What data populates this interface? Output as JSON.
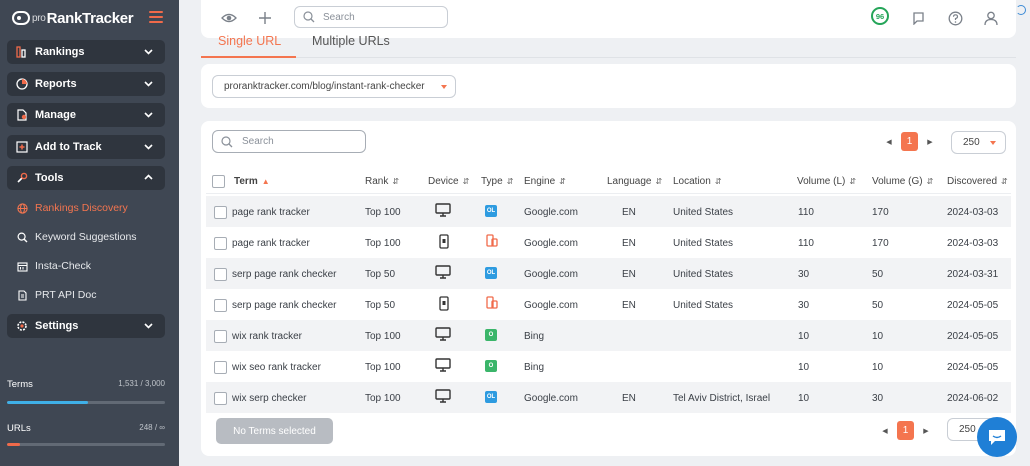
{
  "app": {
    "logo_prefix": "pro",
    "logo_name": "RankTracker"
  },
  "sidebar": {
    "nav": [
      {
        "label": "Rankings",
        "icon": "rankings-icon",
        "expanded": false
      },
      {
        "label": "Reports",
        "icon": "reports-icon",
        "expanded": false
      },
      {
        "label": "Manage",
        "icon": "manage-icon",
        "expanded": false
      },
      {
        "label": "Add to Track",
        "icon": "add-to-track-icon",
        "expanded": false
      },
      {
        "label": "Tools",
        "icon": "tools-icon",
        "expanded": true
      },
      {
        "label": "Settings",
        "icon": "gear-icon",
        "expanded": false
      }
    ],
    "tools_sub": [
      {
        "label": "Rankings Discovery",
        "icon": "globe-icon",
        "active": true
      },
      {
        "label": "Keyword Suggestions",
        "icon": "magnifier-icon",
        "active": false
      },
      {
        "label": "Insta-Check",
        "icon": "calendar-icon",
        "active": false
      },
      {
        "label": "PRT API Doc",
        "icon": "api-doc-icon",
        "active": false
      }
    ],
    "quotas": [
      {
        "label": "Terms",
        "value": "1,531 / 3,000",
        "fraction": 0.51,
        "color": "#3fb0e8"
      },
      {
        "label": "URLs",
        "value": "248 / ∞",
        "fraction": 0.08,
        "color": "#f06a4a"
      }
    ]
  },
  "topbar": {
    "search_placeholder": "Search",
    "score": "96",
    "icons": [
      "eye-icon",
      "plus-icon",
      "flag-icon",
      "help-icon",
      "user-icon"
    ]
  },
  "tabs": [
    {
      "label": "Single URL",
      "active": true
    },
    {
      "label": "Multiple URLs",
      "active": false
    }
  ],
  "url_select": {
    "value": "proranktracker.com/blog/instant-rank-checker"
  },
  "table": {
    "search_placeholder": "Search",
    "current_page": "1",
    "per_page": "250",
    "columns": [
      "Term",
      "Rank",
      "Device",
      "Type",
      "Engine",
      "Language",
      "Location",
      "Volume (L)",
      "Volume (G)",
      "Discovered"
    ],
    "rows": [
      {
        "term": "page rank tracker",
        "rank": "Top 100",
        "device": "desktop",
        "type": "OL",
        "type_color": "#2e9be0",
        "engine": "Google.com",
        "language": "EN",
        "location": "United States",
        "vol_l": "110",
        "vol_g": "170",
        "discovered": "2024-03-03"
      },
      {
        "term": "page rank tracker",
        "rank": "Top 100",
        "device": "mobile",
        "type": "mobile",
        "type_color": "#f06a4a",
        "engine": "Google.com",
        "language": "EN",
        "location": "United States",
        "vol_l": "110",
        "vol_g": "170",
        "discovered": "2024-03-03"
      },
      {
        "term": "serp page rank checker",
        "rank": "Top 50",
        "device": "desktop",
        "type": "OL",
        "type_color": "#2e9be0",
        "engine": "Google.com",
        "language": "EN",
        "location": "United States",
        "vol_l": "30",
        "vol_g": "50",
        "discovered": "2024-03-31"
      },
      {
        "term": "serp page rank checker",
        "rank": "Top 50",
        "device": "mobile",
        "type": "mobile",
        "type_color": "#f06a4a",
        "engine": "Google.com",
        "language": "EN",
        "location": "United States",
        "vol_l": "30",
        "vol_g": "50",
        "discovered": "2024-05-05"
      },
      {
        "term": "wix rank tracker",
        "rank": "Top 100",
        "device": "desktop",
        "type": "O",
        "type_color": "#3bb56a",
        "engine": "Bing",
        "language": "",
        "location": "",
        "vol_l": "10",
        "vol_g": "10",
        "discovered": "2024-05-05"
      },
      {
        "term": "wix seo rank tracker",
        "rank": "Top 100",
        "device": "desktop",
        "type": "O",
        "type_color": "#3bb56a",
        "engine": "Bing",
        "language": "",
        "location": "",
        "vol_l": "10",
        "vol_g": "10",
        "discovered": "2024-05-05"
      },
      {
        "term": "wix serp checker",
        "rank": "Top 100",
        "device": "desktop",
        "type": "OL",
        "type_color": "#2e9be0",
        "engine": "Google.com",
        "language": "EN",
        "location": "Tel Aviv District, Israel",
        "vol_l": "10",
        "vol_g": "30",
        "discovered": "2024-06-02"
      }
    ],
    "bulk_button": "No Terms selected"
  },
  "colors": {
    "accent": "#f4754f",
    "sidebar_bg": "#3f4753",
    "nav_btn_bg": "#2f353e",
    "score_green": "#25a559",
    "chat_blue": "#1f7fd6"
  }
}
